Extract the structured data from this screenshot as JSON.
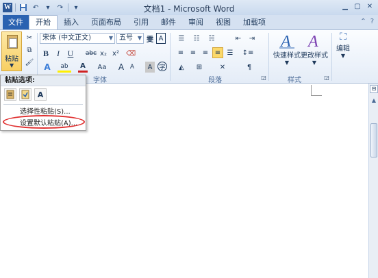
{
  "titlebar": {
    "app_icon": "W",
    "title": "文档1 - Microsoft Word",
    "qat": [
      "save-icon",
      "undo-icon",
      "redo-icon",
      "customize-icon"
    ],
    "controls": [
      "minimize-icon",
      "maximize-icon",
      "close-icon"
    ]
  },
  "tabs": {
    "file": "文件",
    "items": [
      "开始",
      "插入",
      "页面布局",
      "引用",
      "邮件",
      "审阅",
      "视图",
      "加载项"
    ],
    "active": "开始"
  },
  "ribbon": {
    "clipboard": {
      "paste_label": "粘贴"
    },
    "font": {
      "label": "字体",
      "font_name": "宋体 (中文正文)",
      "font_size": "五号",
      "buttons": [
        "B",
        "I",
        "U",
        "abc",
        "x₂",
        "x²",
        "A",
        "Aa",
        "A",
        "A"
      ]
    },
    "paragraph": {
      "label": "段落"
    },
    "styles": {
      "label": "样式",
      "quick_styles": "快速样式",
      "change_styles": "更改样式"
    },
    "editing": {
      "label": "编辑"
    }
  },
  "paste_menu": {
    "header": "粘贴选项:",
    "option_icons": [
      "keep-source-formatting-icon",
      "merge-formatting-icon",
      "keep-text-only-icon"
    ],
    "text_only_glyph": "A",
    "items": [
      "选择性粘贴(S)...",
      "设置默认粘贴(A)..."
    ],
    "highlight_color": "#e03030"
  }
}
